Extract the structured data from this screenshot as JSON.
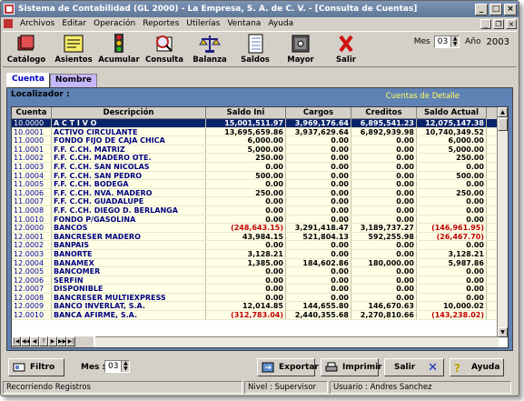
{
  "window": {
    "title": "Sistema de Contabilidad (GL 2000) - La Empresa, S. A. de C. V. - [Consulta de Cuentas]"
  },
  "menu": [
    "Archivos",
    "Editar",
    "Operación",
    "Reportes",
    "Utilerías",
    "Ventana",
    "Ayuda"
  ],
  "toolbar": {
    "buttons": [
      "Catálogo",
      "Asientos",
      "Acumular",
      "Consulta",
      "Balanza",
      "Saldos",
      "Mayor",
      "Salir"
    ],
    "mes_label": "Mes",
    "mes_value": "03",
    "year_label": "Año",
    "year_value": "2003"
  },
  "tabs": [
    "Cuenta",
    "Nombre"
  ],
  "panel": {
    "localizador": "Localizador :",
    "cuentas_detalle": "Cuentas de Detalle"
  },
  "table": {
    "headers": [
      "Cuenta",
      "Descripción",
      "Saldo Ini",
      "Cargos",
      "Creditos",
      "Saldo Actual"
    ],
    "rows": [
      [
        "10.0000",
        "A C T I V O",
        "15,001,511.97",
        "3,969,176.64",
        "6,895,541.23",
        "12,075,147.38"
      ],
      [
        "10.0001",
        "ACTIVO CIRCULANTE",
        "13,695,659.86",
        "3,937,629.64",
        "6,892,939.98",
        "10,740,349.52"
      ],
      [
        "11.0000",
        "FONDO FIJO DE CAJA CHICA",
        "6,000.00",
        "0.00",
        "0.00",
        "6,000.00"
      ],
      [
        "11.0001",
        "F.F. C.CH. MATRIZ",
        "5,000.00",
        "0.00",
        "0.00",
        "5,000.00"
      ],
      [
        "11.0002",
        "F.F. C.CH. MADERO OTE.",
        "250.00",
        "0.00",
        "0.00",
        "250.00"
      ],
      [
        "11.0003",
        "F.F. C.CH. SAN NICOLAS",
        "0.00",
        "0.00",
        "0.00",
        "0.00"
      ],
      [
        "11.0004",
        "F.F. C.CH. SAN PEDRO",
        "500.00",
        "0.00",
        "0.00",
        "500.00"
      ],
      [
        "11.0005",
        "F.F. C.CH. BODEGA",
        "0.00",
        "0.00",
        "0.00",
        "0.00"
      ],
      [
        "11.0006",
        "F.F. C.CH. NVA. MADERO",
        "250.00",
        "0.00",
        "0.00",
        "250.00"
      ],
      [
        "11.0007",
        "F.F. C.CH. GUADALUPE",
        "0.00",
        "0.00",
        "0.00",
        "0.00"
      ],
      [
        "11.0008",
        "F.F. C.CH. DIEGO D. BERLANGA",
        "0.00",
        "0.00",
        "0.00",
        "0.00"
      ],
      [
        "11.0010",
        "FONDO P/GASOLINA",
        "0.00",
        "0.00",
        "0.00",
        "0.00"
      ],
      [
        "12.0000",
        "BANCOS",
        "(248,643.15)",
        "3,291,418.47",
        "3,189,737.27",
        "(146,961.95)"
      ],
      [
        "12.0001",
        "BANCRESER MADERO",
        "43,984.15",
        "521,804.13",
        "592,255.98",
        "(26,467.70)"
      ],
      [
        "12.0002",
        "BANPAIS",
        "0.00",
        "0.00",
        "0.00",
        "0.00"
      ],
      [
        "12.0003",
        "BANORTE",
        "3,128.21",
        "0.00",
        "0.00",
        "3,128.21"
      ],
      [
        "12.0004",
        "BANAMEX",
        "1,385.00",
        "184,602.86",
        "180,000.00",
        "5,987.86"
      ],
      [
        "12.0005",
        "BANCOMER",
        "0.00",
        "0.00",
        "0.00",
        "0.00"
      ],
      [
        "12.0006",
        "SERFIN",
        "0.00",
        "0.00",
        "0.00",
        "0.00"
      ],
      [
        "12.0007",
        "DISPONIBLE",
        "0.00",
        "0.00",
        "0.00",
        "0.00"
      ],
      [
        "12.0008",
        "BANCRESER MULTIEXPRESS",
        "0.00",
        "0.00",
        "0.00",
        "0.00"
      ],
      [
        "12.0009",
        "BANCO INVERLAT, S.A.",
        "12,014.85",
        "144,655.80",
        "146,670.63",
        "10,000.02"
      ],
      [
        "12.0010",
        "BANCA AFIRME, S.A.",
        "(312,783.04)",
        "2,440,355.68",
        "2,270,810.66",
        "(143,238.02)"
      ]
    ]
  },
  "bottom": {
    "filtro": "Filtro",
    "mes_label": "Mes :",
    "mes_value": "03",
    "exportar": "Exportar",
    "imprimir": "Imprimir",
    "salir": "Salir",
    "ayuda": "Ayuda"
  },
  "status": [
    "Recorriendo Registros",
    "Nivel : Supervisor",
    "Usuario : Andres Sanchez"
  ]
}
